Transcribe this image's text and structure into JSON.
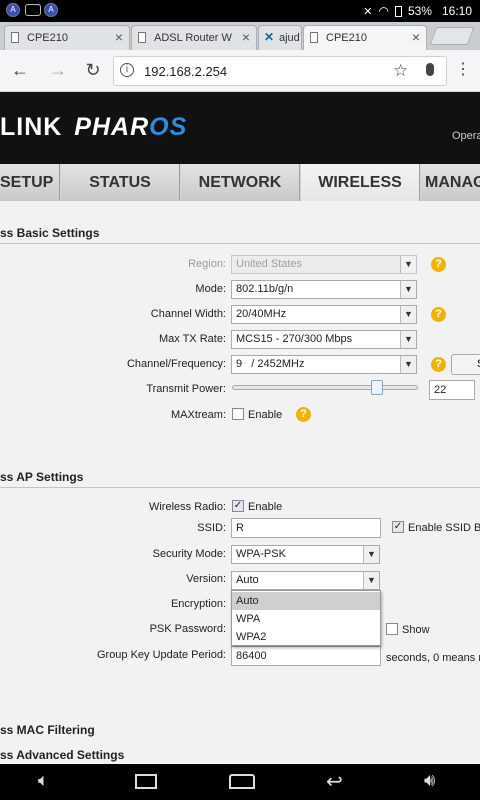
{
  "status_bar": {
    "battery": "53%",
    "time": "16:10"
  },
  "browser": {
    "tabs": [
      {
        "title": "CPE210",
        "active": false
      },
      {
        "title": "ADSL Router W",
        "active": false
      },
      {
        "title": "ajud",
        "active": false
      },
      {
        "title": "CPE210",
        "active": true
      }
    ],
    "url": "192.168.2.254"
  },
  "header": {
    "logo_link": "LINK",
    "logo_pharos": "PHAR",
    "logo_os": "OS",
    "right_text": "Opera"
  },
  "nav": {
    "tabs": [
      "SETUP",
      "STATUS",
      "NETWORK",
      "WIRELESS",
      "MANAG"
    ],
    "active": "WIRELESS"
  },
  "basic": {
    "title": "ss Basic Settings",
    "region_label": "Region:",
    "region_value": "United States",
    "mode_label": "Mode:",
    "mode_value": "802.11b/g/n",
    "channel_width_label": "Channel Width:",
    "channel_width_value": "20/40MHz",
    "max_tx_label": "Max TX Rate:",
    "max_tx_value": "MCS15 - 270/300 Mbps",
    "channel_label": "Channel/Frequency:",
    "channel_value": "9   / 2452MHz",
    "survey_button": "S",
    "tx_power_label": "Transmit Power:",
    "tx_power_value": "22",
    "tx_power_fraction": 0.8,
    "maxtream_label": "MAXtream:",
    "maxtream_enable": "Enable",
    "maxtream_checked": false
  },
  "ap": {
    "title": "ss AP Settings",
    "radio_label": "Wireless Radio:",
    "radio_enable": "Enable",
    "radio_checked": true,
    "ssid_label": "SSID:",
    "ssid_value": "R",
    "ssid_broadcast": "Enable SSID Br",
    "ssid_broadcast_checked": true,
    "security_label": "Security Mode:",
    "security_value": "WPA-PSK",
    "version_label": "Version:",
    "version_value": "Auto",
    "version_options": [
      "Auto",
      "WPA",
      "WPA2"
    ],
    "encryption_label": "Encryption:",
    "psk_label": "PSK Password:",
    "psk_show": "Show",
    "psk_show_checked": false,
    "gk_label": "Group Key Update Period:",
    "gk_value": "86400",
    "gk_suffix": "seconds, 0 means n"
  },
  "mac_filter_title": "ss MAC Filtering",
  "advanced_title": "ss Advanced Settings",
  "icons": {
    "help": "help-icon",
    "check": "checkmark"
  }
}
